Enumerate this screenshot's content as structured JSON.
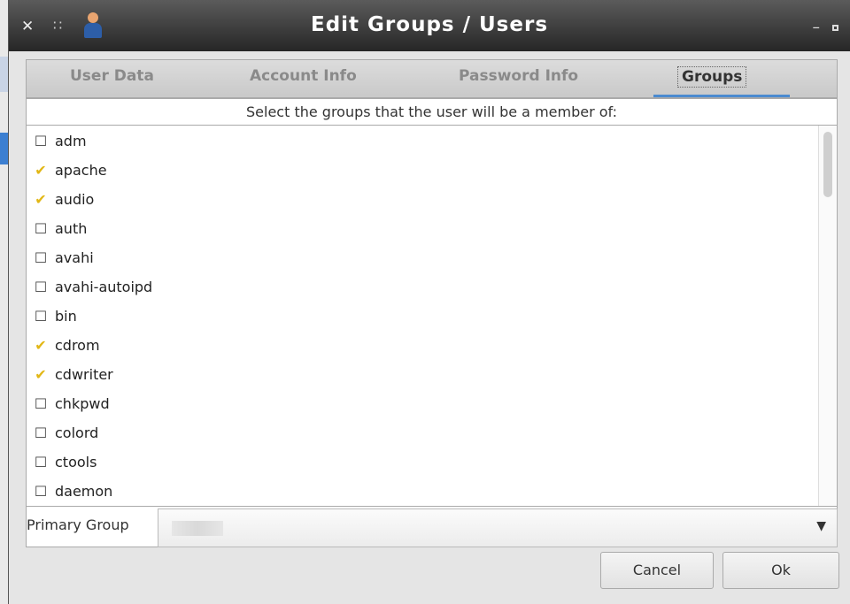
{
  "window": {
    "title": "Edit Groups / Users"
  },
  "tabs": [
    {
      "label": "User Data",
      "active": false
    },
    {
      "label": "Account Info",
      "active": false
    },
    {
      "label": "Password Info",
      "active": false
    },
    {
      "label": "Groups",
      "active": true
    }
  ],
  "instruction": "Select the groups that the user will be a member of:",
  "groups": [
    {
      "name": "adm",
      "checked": false
    },
    {
      "name": "apache",
      "checked": true
    },
    {
      "name": "audio",
      "checked": true
    },
    {
      "name": "auth",
      "checked": false
    },
    {
      "name": "avahi",
      "checked": false
    },
    {
      "name": "avahi-autoipd",
      "checked": false
    },
    {
      "name": "bin",
      "checked": false
    },
    {
      "name": "cdrom",
      "checked": true
    },
    {
      "name": "cdwriter",
      "checked": true
    },
    {
      "name": "chkpwd",
      "checked": false
    },
    {
      "name": "colord",
      "checked": false
    },
    {
      "name": "ctools",
      "checked": false
    },
    {
      "name": "daemon",
      "checked": false
    }
  ],
  "icons": {
    "checked": "check-icon",
    "unchecked": "empty-checkbox-icon"
  },
  "primary_group": {
    "label": "Primary Group"
  },
  "buttons": {
    "cancel": "Cancel",
    "ok": "Ok"
  }
}
